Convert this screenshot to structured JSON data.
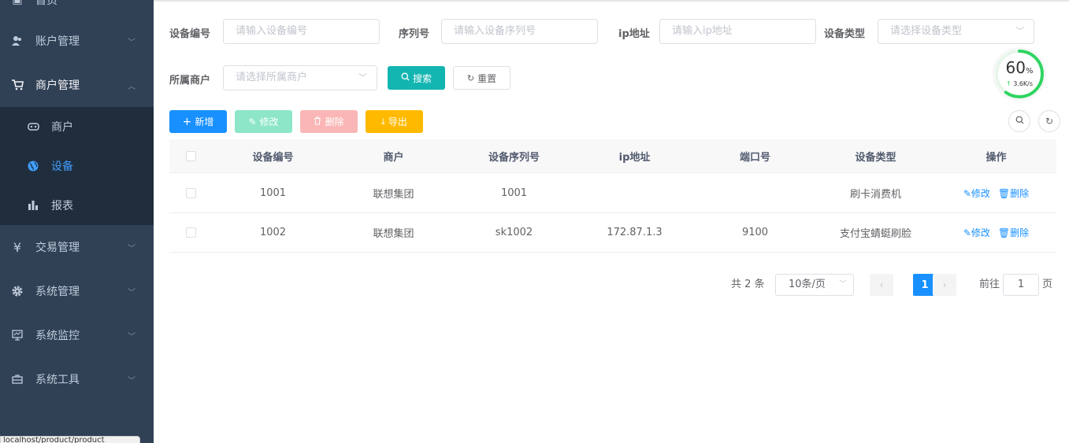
{
  "sidebar": {
    "items": [
      {
        "label": "首页",
        "icon": "home-icon"
      },
      {
        "label": "账户管理",
        "icon": "user-icon"
      },
      {
        "label": "商户管理",
        "icon": "cart-icon"
      },
      {
        "label": "交易管理",
        "icon": "yen-icon"
      },
      {
        "label": "系统管理",
        "icon": "gear-icon"
      },
      {
        "label": "系统监控",
        "icon": "monitor-icon"
      },
      {
        "label": "系统工具",
        "icon": "toolbox-icon"
      }
    ],
    "submenu": [
      {
        "label": "商户",
        "icon": "merchant-icon"
      },
      {
        "label": "设备",
        "icon": "globe-icon"
      },
      {
        "label": "报表",
        "icon": "bar-chart-icon"
      }
    ],
    "active_submenu": "设备",
    "status_url": "localhost/product/product"
  },
  "filters": {
    "device_no": {
      "label": "设备编号",
      "placeholder": "请输入设备编号"
    },
    "serial": {
      "label": "序列号",
      "placeholder": "请输入设备序列号"
    },
    "ip": {
      "label": "ip地址",
      "placeholder": "请输入ip地址"
    },
    "device_type": {
      "label": "设备类型",
      "placeholder": "请选择设备类型"
    },
    "merchant": {
      "label": "所属商户",
      "placeholder": "请选择所属商户"
    },
    "search_label": "搜索",
    "reset_label": "重置"
  },
  "toolbar": {
    "add_label": "新增",
    "edit_label": "修改",
    "delete_label": "删除",
    "export_label": "导出"
  },
  "table": {
    "columns": [
      "设备编号",
      "商户",
      "设备序列号",
      "ip地址",
      "端口号",
      "设备类型",
      "操作"
    ],
    "rows": [
      {
        "device_no": "1001",
        "merchant": "联想集团",
        "serial": "1001",
        "ip": "",
        "port": "",
        "type": "刷卡消费机"
      },
      {
        "device_no": "1002",
        "merchant": "联想集团",
        "serial": "sk1002",
        "ip": "172.87.1.3",
        "port": "9100",
        "type": "支付宝蜻蜓刷脸"
      }
    ],
    "edit_label": "修改",
    "delete_label": "删除"
  },
  "pagination": {
    "total_text": "共 2 条",
    "page_size": "10条/页",
    "current_page": "1",
    "goto_label": "前往",
    "goto_value": "1",
    "page_unit": "页"
  },
  "speed_widget": {
    "percent": "60",
    "percent_unit": "%",
    "rate": "3.6K/s",
    "progress": 0.6
  },
  "colors": {
    "sidebar_bg": "#304156",
    "submenu_bg": "#1f2d3d",
    "active": "#409eff",
    "primary": "#1890ff",
    "search": "#13b5b1",
    "export": "#ffba00"
  }
}
